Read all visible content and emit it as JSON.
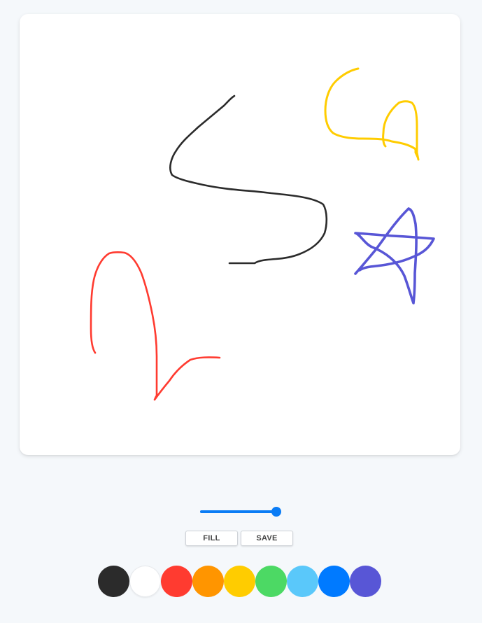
{
  "canvas": {
    "background": "#ffffff",
    "strokes": [
      {
        "name": "black-s-stroke",
        "color": "#2b2b2b"
      },
      {
        "name": "yellow-stroke",
        "color": "#ffcc00"
      },
      {
        "name": "purple-star-stroke",
        "color": "#5856d6"
      },
      {
        "name": "red-stroke",
        "color": "#ff3b30"
      }
    ]
  },
  "brush_size": {
    "value": 1.0,
    "accent": "#0a7cf5"
  },
  "toolbar": {
    "fill_label": "FILL",
    "save_label": "SAVE"
  },
  "palette": [
    {
      "name": "black",
      "hex": "#2b2b2b"
    },
    {
      "name": "white",
      "hex": "#ffffff"
    },
    {
      "name": "red",
      "hex": "#ff3b30"
    },
    {
      "name": "orange",
      "hex": "#ff9500"
    },
    {
      "name": "yellow",
      "hex": "#ffcc00"
    },
    {
      "name": "green",
      "hex": "#4cd964"
    },
    {
      "name": "light-blue",
      "hex": "#5ac8fa"
    },
    {
      "name": "blue",
      "hex": "#007aff"
    },
    {
      "name": "purple",
      "hex": "#5856d6"
    }
  ]
}
